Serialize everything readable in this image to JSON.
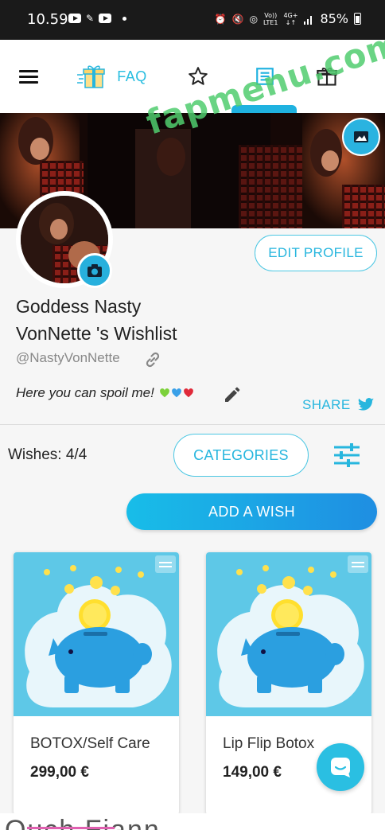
{
  "status_bar": {
    "time": "10.59",
    "battery": "85%",
    "network_top": "Vo))",
    "network_bottom": "LTE1",
    "signal_top": "4G+",
    "signal_bottom": "↓↑"
  },
  "nav": {
    "faq_label": "FAQ",
    "icons": [
      "menu-icon",
      "gift-icon",
      "star-icon",
      "list-icon",
      "gift-box-icon"
    ],
    "active_tab": "list-icon"
  },
  "watermark": "fapmenu.com",
  "profile": {
    "edit_label": "EDIT PROFILE",
    "name_line1": "Goddess Nasty",
    "name_line2": "VonNette 's Wishlist",
    "handle": "@NastyVonNette",
    "bio": "Here you can spoil me!",
    "bio_emojis": [
      "green-heart",
      "blue-heart",
      "red-heart"
    ],
    "share_label": "SHARE"
  },
  "wishes": {
    "count_label": "Wishes: 4/4",
    "categories_label": "CATEGORIES",
    "add_label": "ADD A WISH",
    "items": [
      {
        "title": "BOTOX/Self Care",
        "price": "299,00 €"
      },
      {
        "title": "Lip Flip Botox",
        "price": "149,00 €"
      }
    ]
  },
  "bottom_peek_text": "Ouch Fiann...",
  "colors": {
    "accent": "#27b6de",
    "button_gradient_start": "#18bde8",
    "button_gradient_end": "#1f8ee2",
    "card_bg": "#5ec8e7",
    "status_bar": "#1a1a1a",
    "watermark": "#50cd6e"
  }
}
